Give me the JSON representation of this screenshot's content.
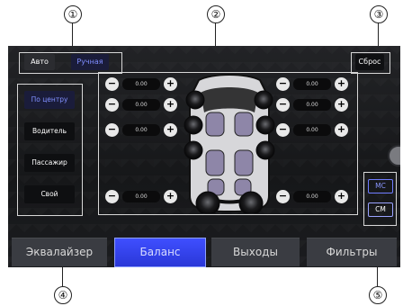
{
  "callouts": [
    "①",
    "②",
    "③",
    "④",
    "⑤"
  ],
  "top": {
    "mode_auto": "Авто",
    "mode_manual": "Ручная",
    "reset": "Сброс"
  },
  "presets": [
    {
      "label": "По центру",
      "active": true
    },
    {
      "label": "Водитель",
      "active": false
    },
    {
      "label": "Пассажир",
      "active": false
    },
    {
      "label": "Свой",
      "active": false
    }
  ],
  "speaker_controls": [
    {
      "value": "0.00"
    },
    {
      "value": "0.00"
    },
    {
      "value": "0.00"
    },
    {
      "value": "0.00"
    },
    {
      "value": "0.00"
    },
    {
      "value": "0.00"
    },
    {
      "value": "0.00"
    },
    {
      "value": "0.00"
    }
  ],
  "units": {
    "mc": "МС",
    "cm": "СМ",
    "active": "mc"
  },
  "tabs": [
    {
      "label": "Эквалайзер",
      "active": false
    },
    {
      "label": "Баланс",
      "active": true
    },
    {
      "label": "Выходы",
      "active": false
    },
    {
      "label": "Фильтры",
      "active": false
    }
  ],
  "symbols": {
    "minus": "−",
    "plus": "+"
  },
  "colors": {
    "accent": "#7e8cff",
    "tab_active": "#2f3cff",
    "panel_bg": "#1c1d20"
  }
}
